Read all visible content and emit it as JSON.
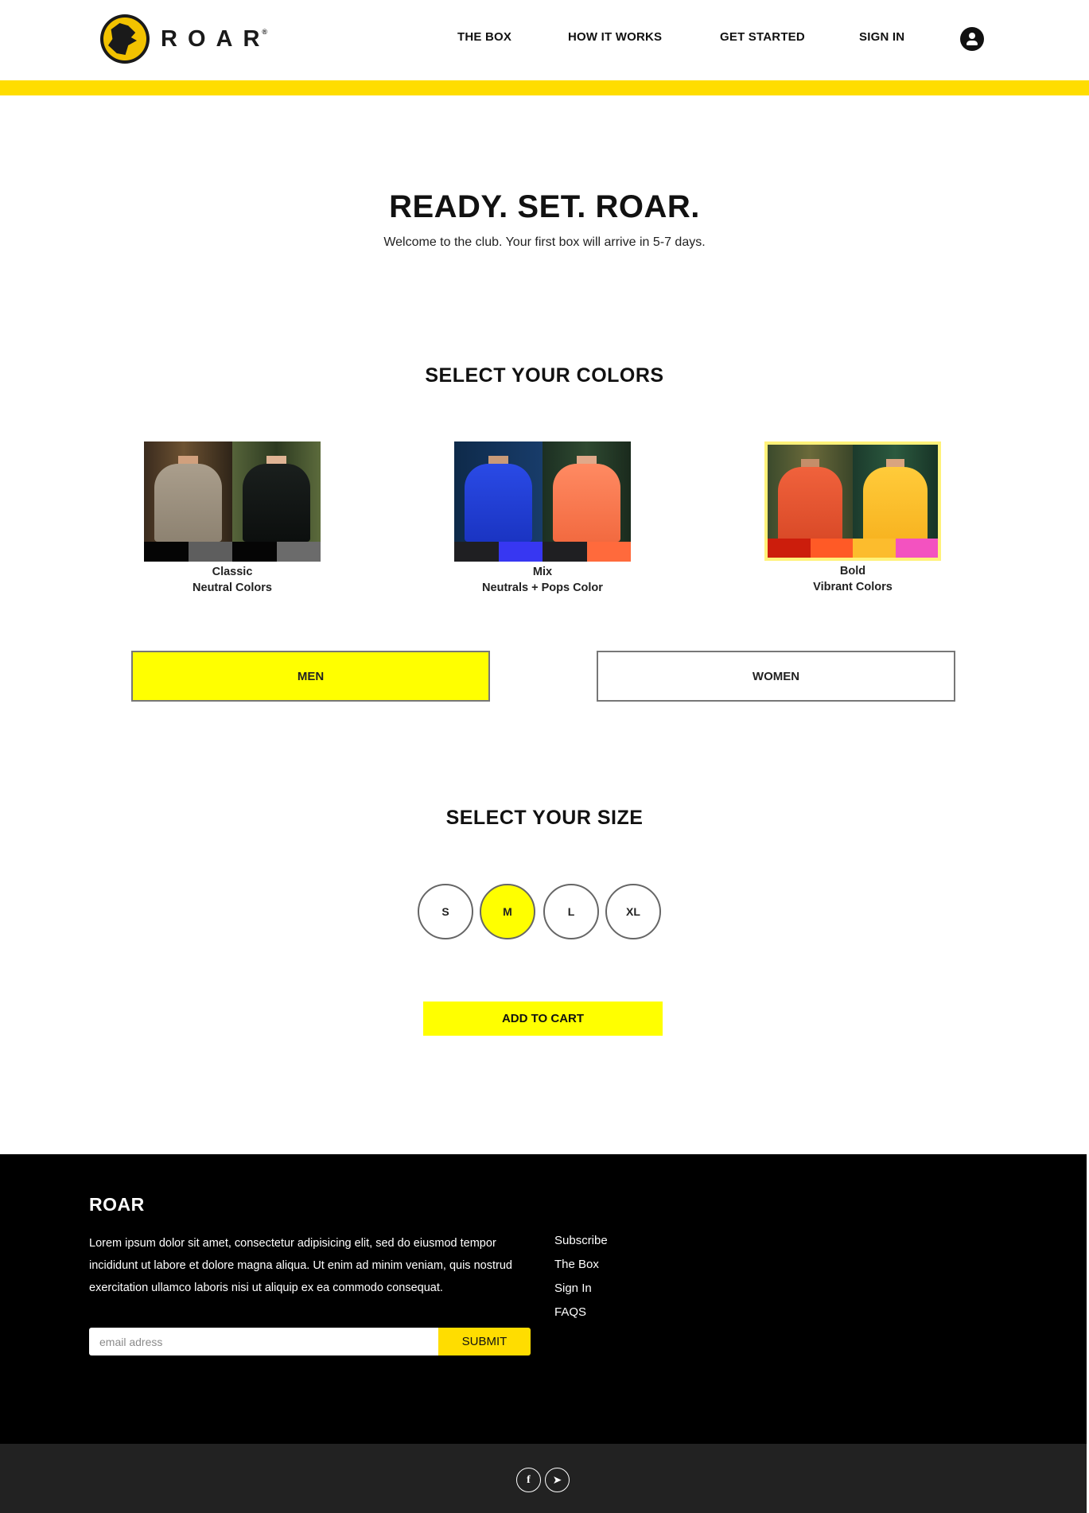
{
  "header": {
    "brand": "ROAR",
    "brand_mark": "®",
    "nav": [
      "THE BOX",
      "HOW IT WORKS",
      "GET STARTED",
      "SIGN IN"
    ],
    "account_icon": "account-circle-icon",
    "accent_color": "#ffdd00"
  },
  "hero": {
    "title": "READY. SET. ROAR.",
    "subtitle": "Welcome to the club. Your first box will arrive in 5-7 days."
  },
  "colors_section": {
    "title": "SELECT YOUR COLORS",
    "options": [
      {
        "name": "Classic",
        "description": "Neutral Colors",
        "selected": false,
        "swatches": [
          "#050505",
          "#5e5e5e",
          "#050505",
          "#6b6b6b"
        ],
        "shirt_colors": [
          "#9a8f7e",
          "#111614"
        ]
      },
      {
        "name": "Mix",
        "description": "Neutrals + Pops Color",
        "selected": false,
        "swatches": [
          "#1f1f22",
          "#3737f2",
          "#1f1f22",
          "#ff6a3c"
        ],
        "shirt_colors": [
          "#1f3fd8",
          "#ff7a4f"
        ]
      },
      {
        "name": "Bold",
        "description": "Vibrant Colors",
        "selected": true,
        "swatches": [
          "#cc1d0c",
          "#ff5a26",
          "#fcbc2d",
          "#f352c0"
        ],
        "shirt_colors": [
          "#e8522e",
          "#ffbf2e"
        ]
      }
    ]
  },
  "gender": {
    "options": [
      "MEN",
      "WOMEN"
    ],
    "selected": "MEN"
  },
  "size_section": {
    "title": "SELECT YOUR SIZE",
    "options": [
      "S",
      "M",
      "L",
      "XL"
    ],
    "selected": "M"
  },
  "cart": {
    "label": "ADD TO CART"
  },
  "footer": {
    "brand": "ROAR",
    "text": "Lorem ipsum dolor sit amet, consectetur adipisicing elit, sed do eiusmod tempor incididunt ut labore et dolore magna aliqua. Ut enim ad minim veniam, quis nostrud exercitation ullamco laboris nisi ut aliquip ex ea commodo consequat.",
    "email_placeholder": "email adress",
    "submit_label": "SUBMIT",
    "links": [
      "Subscribe",
      "The Box",
      "Sign In",
      "FAQS"
    ]
  },
  "social": {
    "icons": [
      "facebook-icon",
      "telegram-icon"
    ],
    "facebook_glyph": "f",
    "telegram_glyph": "➤"
  }
}
